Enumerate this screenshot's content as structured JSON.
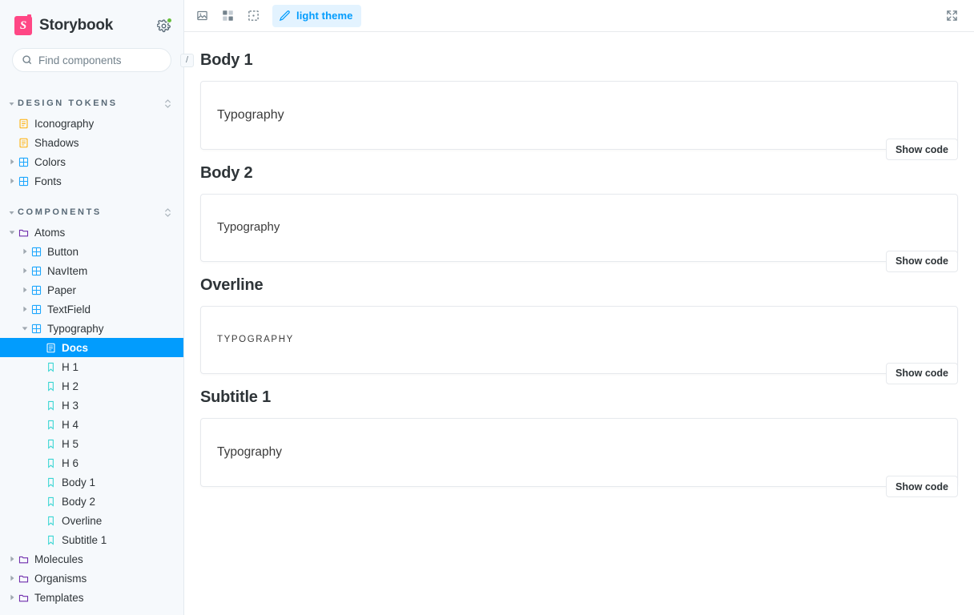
{
  "sidebar": {
    "brand": {
      "name": "Storybook",
      "logo_letter": "S",
      "logo_color": "#FF4785"
    },
    "theme_toggle": {
      "name": "theme-toggle",
      "status_color": "#66BF3C"
    },
    "search": {
      "placeholder": "Find components",
      "value": "",
      "shortcut": "/"
    },
    "sections": [
      {
        "title": "DESIGN TOKENS",
        "expanded": true,
        "items": [
          {
            "label": "Iconography",
            "icon": "document-icon",
            "depth": 1,
            "type": "docs",
            "expandable": false,
            "selected": false
          },
          {
            "label": "Shadows",
            "icon": "document-icon",
            "depth": 1,
            "type": "docs",
            "expandable": false,
            "selected": false
          },
          {
            "label": "Colors",
            "icon": "component-icon",
            "depth": 1,
            "type": "component",
            "expandable": true,
            "expanded": false,
            "selected": false
          },
          {
            "label": "Fonts",
            "icon": "component-icon",
            "depth": 1,
            "type": "component",
            "expandable": true,
            "expanded": false,
            "selected": false
          }
        ]
      },
      {
        "title": "COMPONENTS",
        "expanded": true,
        "items": [
          {
            "label": "Atoms",
            "icon": "folder-icon",
            "depth": 1,
            "type": "folder",
            "expandable": true,
            "expanded": true,
            "selected": false
          },
          {
            "label": "Button",
            "icon": "component-icon",
            "depth": 2,
            "type": "component",
            "expandable": true,
            "expanded": false,
            "selected": false
          },
          {
            "label": "NavItem",
            "icon": "component-icon",
            "depth": 2,
            "type": "component",
            "expandable": true,
            "expanded": false,
            "selected": false
          },
          {
            "label": "Paper",
            "icon": "component-icon",
            "depth": 2,
            "type": "component",
            "expandable": true,
            "expanded": false,
            "selected": false
          },
          {
            "label": "TextField",
            "icon": "component-icon",
            "depth": 2,
            "type": "component",
            "expandable": true,
            "expanded": false,
            "selected": false
          },
          {
            "label": "Typography",
            "icon": "component-icon",
            "depth": 2,
            "type": "component",
            "expandable": true,
            "expanded": true,
            "selected": false
          },
          {
            "label": "Docs",
            "icon": "document-icon",
            "depth": 3,
            "type": "docs",
            "expandable": false,
            "selected": true
          },
          {
            "label": "H 1",
            "icon": "story-icon",
            "depth": 3,
            "type": "story",
            "expandable": false,
            "selected": false
          },
          {
            "label": "H 2",
            "icon": "story-icon",
            "depth": 3,
            "type": "story",
            "expandable": false,
            "selected": false
          },
          {
            "label": "H 3",
            "icon": "story-icon",
            "depth": 3,
            "type": "story",
            "expandable": false,
            "selected": false
          },
          {
            "label": "H 4",
            "icon": "story-icon",
            "depth": 3,
            "type": "story",
            "expandable": false,
            "selected": false
          },
          {
            "label": "H 5",
            "icon": "story-icon",
            "depth": 3,
            "type": "story",
            "expandable": false,
            "selected": false
          },
          {
            "label": "H 6",
            "icon": "story-icon",
            "depth": 3,
            "type": "story",
            "expandable": false,
            "selected": false
          },
          {
            "label": "Body 1",
            "icon": "story-icon",
            "depth": 3,
            "type": "story",
            "expandable": false,
            "selected": false
          },
          {
            "label": "Body 2",
            "icon": "story-icon",
            "depth": 3,
            "type": "story",
            "expandable": false,
            "selected": false
          },
          {
            "label": "Overline",
            "icon": "story-icon",
            "depth": 3,
            "type": "story",
            "expandable": false,
            "selected": false
          },
          {
            "label": "Subtitle 1",
            "icon": "story-icon",
            "depth": 3,
            "type": "story",
            "expandable": false,
            "selected": false
          },
          {
            "label": "Molecules",
            "icon": "folder-icon",
            "depth": 1,
            "type": "folder",
            "expandable": true,
            "expanded": false,
            "selected": false
          },
          {
            "label": "Organisms",
            "icon": "folder-icon",
            "depth": 1,
            "type": "folder",
            "expandable": true,
            "expanded": false,
            "selected": false
          },
          {
            "label": "Templates",
            "icon": "folder-icon",
            "depth": 1,
            "type": "folder",
            "expandable": true,
            "expanded": false,
            "selected": false
          }
        ]
      }
    ]
  },
  "toolbar": {
    "buttons": [
      {
        "name": "zoom-image-icon",
        "label": ""
      },
      {
        "name": "grid-background-icon",
        "label": ""
      },
      {
        "name": "outline-icon",
        "label": ""
      }
    ],
    "theme_pill": {
      "label": "light theme",
      "icon": "pencil-icon",
      "active": true,
      "accent": "#029CFD",
      "background": "#E3F3FF"
    },
    "fullscreen": {
      "name": "fullscreen-icon"
    }
  },
  "main": {
    "blocks": [
      {
        "title": "Body 1",
        "sample_text": "Typography",
        "style": "s-body1",
        "show_code_label": "Show code"
      },
      {
        "title": "Body 2",
        "sample_text": "Typography",
        "style": "s-body2",
        "show_code_label": "Show code"
      },
      {
        "title": "Overline",
        "sample_text": "Typography",
        "style": "s-overline",
        "show_code_label": "Show code"
      },
      {
        "title": "Subtitle 1",
        "sample_text": "Typography",
        "style": "s-subtitle1",
        "show_code_label": "Show code"
      }
    ]
  }
}
